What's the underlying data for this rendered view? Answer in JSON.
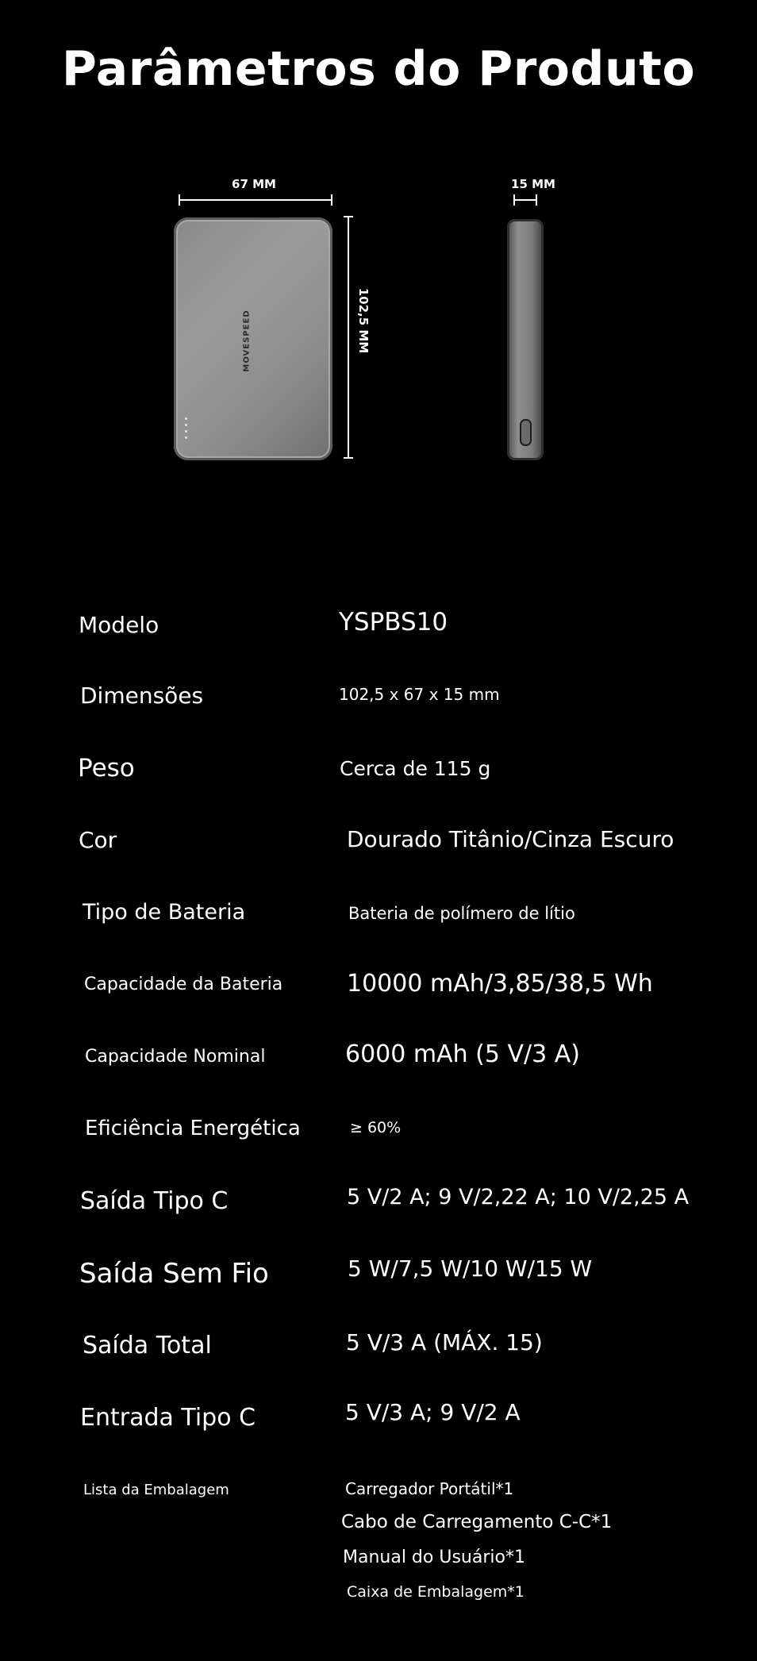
{
  "title": "Parâmetros do Produto",
  "illustration": {
    "width_label": "67 MM",
    "depth_label": "15 MM",
    "height_label": "102,5 MM",
    "brand": "MOVESPEED"
  },
  "specs": [
    {
      "label": "Modelo",
      "value": "YSPBS10"
    },
    {
      "label": "Dimensões",
      "value": "102,5 x 67 x 15 mm"
    },
    {
      "label": "Peso",
      "value": "Cerca de 115 g"
    },
    {
      "label": "Cor",
      "value": "Dourado Titânio/Cinza Escuro"
    },
    {
      "label": "Tipo de Bateria",
      "value": "Bateria de polímero de lítio"
    },
    {
      "label": "Capacidade da Bateria",
      "value": "10000 mAh/3,85/38,5 Wh"
    },
    {
      "label": "Capacidade Nominal",
      "value": "6000 mAh (5 V/3 A)"
    },
    {
      "label": "Eficiência Energética",
      "value": "≥ 60%"
    },
    {
      "label": "Saída Tipo C",
      "value": "5 V/2 A; 9 V/2,22 A; 10 V/2,25 A"
    },
    {
      "label": "Saída Sem Fio",
      "value": "5 W/7,5 W/10 W/15 W"
    },
    {
      "label": "Saída Total",
      "value": "5 V/3 A (MÁX. 15)"
    },
    {
      "label": "Entrada Tipo C",
      "value": "5 V/3 A; 9 V/2 A"
    }
  ],
  "package": {
    "label": "Lista da Embalagem",
    "items": [
      "Carregador Portátil*1",
      "Cabo de Carregamento C-C*1",
      "Manual do Usuário*1",
      "Caixa de Embalagem*1"
    ]
  }
}
